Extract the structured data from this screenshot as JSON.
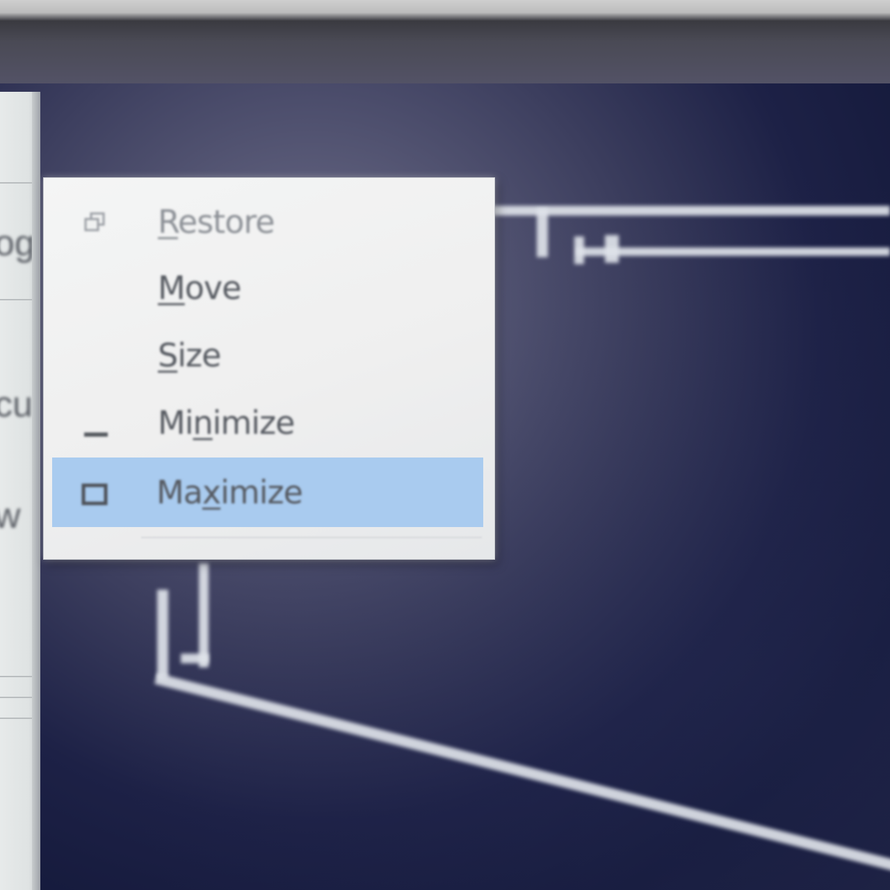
{
  "left_window": {
    "text_rows": [
      "og",
      "cu",
      "w"
    ]
  },
  "context_menu": {
    "items": [
      {
        "pre": "",
        "accel": "R",
        "post": "estore",
        "icon": "restore-icon",
        "enabled": false,
        "highlighted": false
      },
      {
        "pre": "",
        "accel": "M",
        "post": "ove",
        "icon": "",
        "enabled": true,
        "highlighted": false
      },
      {
        "pre": "",
        "accel": "S",
        "post": "ize",
        "icon": "",
        "enabled": true,
        "highlighted": false
      },
      {
        "pre": "Mi",
        "accel": "n",
        "post": "imize",
        "icon": "minimize-icon",
        "enabled": true,
        "highlighted": false
      },
      {
        "pre": "Ma",
        "accel": "x",
        "post": "imize",
        "icon": "maximize-icon",
        "enabled": true,
        "highlighted": true
      }
    ]
  },
  "colors": {
    "highlight": "#a9cbef",
    "menu_bg": "#f0f1f1",
    "desktop_dark": "#1d2146"
  }
}
